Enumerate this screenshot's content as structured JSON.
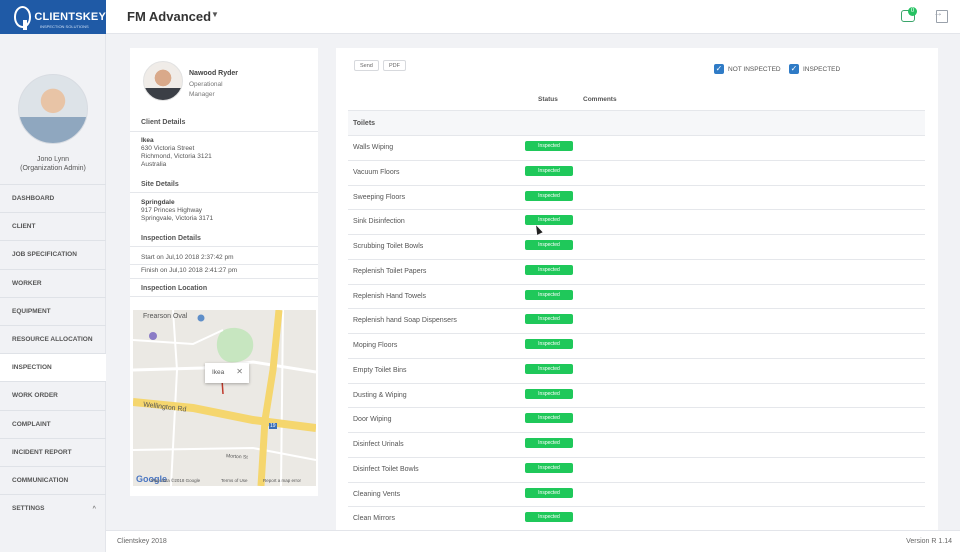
{
  "brand": {
    "name": "CLIENTSKEY",
    "tagline": "INSPECTION SOLUTIONS"
  },
  "header": {
    "app_title": "FM Advanced",
    "notifications_count": "0"
  },
  "user": {
    "name": "Jono Lynn",
    "role": "(Organization Admin)"
  },
  "nav": {
    "items": [
      {
        "label": "DASHBOARD"
      },
      {
        "label": "CLIENT"
      },
      {
        "label": "JOB SPECIFICATION"
      },
      {
        "label": "WORKER"
      },
      {
        "label": "EQUIPMENT"
      },
      {
        "label": "RESOURCE ALLOCATION"
      },
      {
        "label": "INSPECTION"
      },
      {
        "label": "WORK ORDER"
      },
      {
        "label": "COMPLAINT"
      },
      {
        "label": "INCIDENT REPORT"
      },
      {
        "label": "COMMUNICATION"
      },
      {
        "label": "SETTINGS"
      }
    ],
    "active": "INSPECTION"
  },
  "inspector": {
    "name": "Nawood Ryder",
    "role_line1": "Operational",
    "role_line2": "Manager"
  },
  "client_details": {
    "title": "Client Details",
    "name": "Ikea",
    "line1": "630 Victoria Street",
    "line2": "Richmond, Victoria 3121",
    "line3": "Australia"
  },
  "site_details": {
    "title": "Site Details",
    "name": "Springdale",
    "line1": "917 Princes Highway",
    "line2": "Springvale, Victoria 3171"
  },
  "inspection_details": {
    "title": "Inspection Details",
    "start": "Start on Jul,10 2018 2:37:42 pm",
    "finish": "Finish on Jul,10 2018 2:41:27 pm"
  },
  "inspection_location": {
    "title": "Inspection Location",
    "map_labels": {
      "park": "Frearson Oval",
      "road": "Wellington Rd",
      "street": "Morton St",
      "route": "19",
      "popup": "Ikea",
      "attribution": "Map data ©2018 Google",
      "terms": "Terms of Use",
      "report": "Report a map error",
      "google": "Google"
    }
  },
  "actions": {
    "send": "Send",
    "pdf": "PDF"
  },
  "filters": {
    "not_inspected": "NOT INSPECTED",
    "inspected": "INSPECTED"
  },
  "table": {
    "headers": {
      "status": "Status",
      "comments": "Comments"
    },
    "group": "Toilets",
    "rows": [
      {
        "task": "Walls Wiping",
        "status": "Inspected"
      },
      {
        "task": "Vacuum Floors",
        "status": "Inspected"
      },
      {
        "task": "Sweeping Floors",
        "status": "Inspected"
      },
      {
        "task": "Sink Disinfection",
        "status": "Inspected"
      },
      {
        "task": "Scrubbing Toilet Bowls",
        "status": "Inspected"
      },
      {
        "task": "Replenish Toilet Papers",
        "status": "Inspected"
      },
      {
        "task": "Replenish Hand Towels",
        "status": "Inspected"
      },
      {
        "task": "Replenish hand Soap Dispensers",
        "status": "Inspected"
      },
      {
        "task": "Moping Floors",
        "status": "Inspected"
      },
      {
        "task": "Empty Toilet Bins",
        "status": "Inspected"
      },
      {
        "task": "Dusting & Wiping",
        "status": "Inspected"
      },
      {
        "task": "Door Wiping",
        "status": "Inspected"
      },
      {
        "task": "Disinfect Urinals",
        "status": "Inspected"
      },
      {
        "task": "Disinfect Toilet Bowls",
        "status": "Inspected"
      },
      {
        "task": "Cleaning Vents",
        "status": "Inspected"
      },
      {
        "task": "Clean Mirrors",
        "status": "Inspected"
      }
    ]
  },
  "footer": {
    "copyright": "Clientskey 2018",
    "version": "Version R 1.14"
  },
  "colors": {
    "brand": "#1f5aa6",
    "inspected": "#1fc85a",
    "checkbox": "#2f7bc6"
  }
}
